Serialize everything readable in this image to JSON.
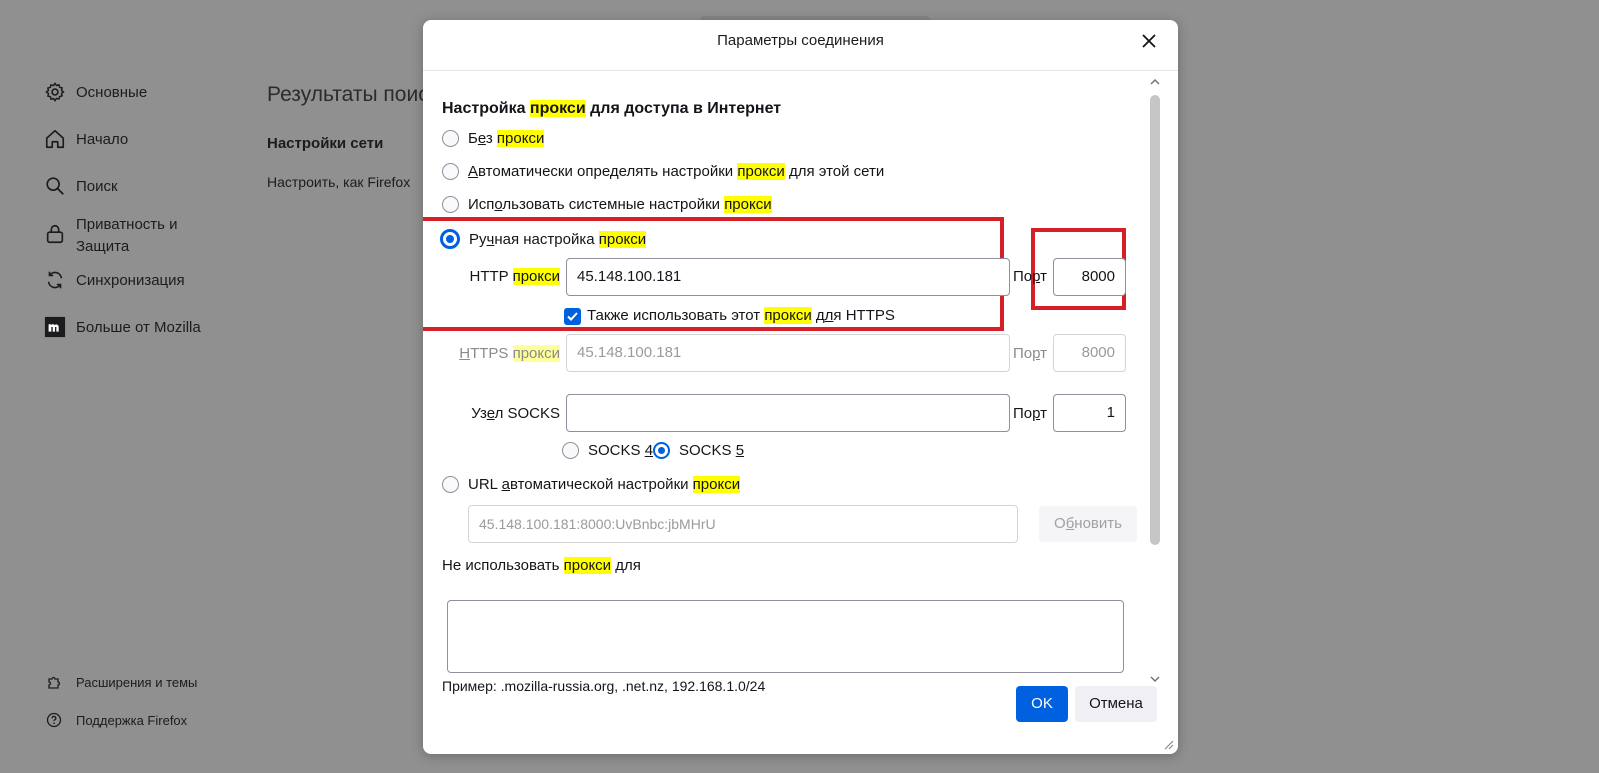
{
  "background": {
    "nav": [
      {
        "label": "Основные",
        "icon": "gear-icon"
      },
      {
        "label": "Начало",
        "icon": "home-icon"
      },
      {
        "label": "Поиск",
        "icon": "search-icon"
      },
      {
        "label": "Приватность и Защита",
        "line1": "Приватность и",
        "line2": "Защита",
        "icon": "lock-icon"
      },
      {
        "label": "Синхронизация",
        "icon": "sync-icon"
      },
      {
        "label": "Больше от Mozilla",
        "icon": "mozilla-icon"
      }
    ],
    "footer": [
      {
        "label": "Расширения и темы",
        "icon": "puzzle-icon"
      },
      {
        "label": "Поддержка Firefox",
        "icon": "help-icon"
      }
    ],
    "results_title": "Результаты поис",
    "section_title": "Настройки сети",
    "section_text": "Настроить, как Firefox"
  },
  "dialog": {
    "title": "Параметры соединения",
    "heading": {
      "pre": "Настройка ",
      "hl": "прокси",
      "post": " для доступа в Интернет"
    },
    "options": {
      "no_proxy": {
        "pre": "Б",
        "u": "е",
        "mid": "з ",
        "hl": "прокси",
        "post": ""
      },
      "auto_detect": {
        "pre": "",
        "u": "А",
        "mid": "втоматически определять настройки ",
        "hl": "прокси",
        "post": " для этой сети"
      },
      "system": {
        "pre": "Исп",
        "u": "о",
        "mid": "льзовать системные настройки ",
        "hl": "прокси",
        "post": ""
      },
      "manual": {
        "pre": "Ру",
        "u": "ч",
        "mid": "ная настройка ",
        "hl": "прокси",
        "post": ""
      },
      "auto_url": {
        "pre": "URL ",
        "u": "а",
        "mid": "втоматической настройки ",
        "hl": "прокси",
        "post": ""
      }
    },
    "selected_option": "manual",
    "http_label": {
      "pre": "HTTP ",
      "hl": "прокси"
    },
    "http_value": "45.148.100.181",
    "port_label": {
      "pre": "По",
      "u": "р",
      "post": "т"
    },
    "http_port": "8000",
    "also_https": {
      "pre": "Также использовать этот ",
      "hl": "прокси",
      "mid": " д",
      "u": "л",
      "post": "я HTTPS"
    },
    "also_https_checked": true,
    "https_label": {
      "u": "H",
      "pre": "TTPS ",
      "hl": "прокси"
    },
    "https_value": "45.148.100.181",
    "https_port": "8000",
    "socks_label": {
      "pre": "Узел SOCKS",
      "u_index": 1
    },
    "socks_label_parts": {
      "pre": "Уз",
      "u": "е",
      "post": "л SOCKS"
    },
    "socks_value": "",
    "socks_port": "1",
    "socks4": {
      "pre": "SOCKS ",
      "u": "4"
    },
    "socks5": {
      "pre": "SOCKS ",
      "u": "5"
    },
    "socks_version": "5",
    "auto_url_value": "45.148.100.181:8000:UvBnbc:jbMHrU",
    "refresh": {
      "pre": "О",
      "u": "б",
      "post": "новить"
    },
    "no_proxy_for": {
      "pre": "Не использовать ",
      "hl": "прокси",
      "post": " для"
    },
    "no_proxy_value": "",
    "example": "Пример: .mozilla-russia.org, .net.nz, 192.168.1.0/24",
    "ok": "OK",
    "cancel": "Отмена"
  },
  "colors": {
    "accent": "#0061e0",
    "highlight": "#ffff00",
    "annotation": "#d52027"
  }
}
